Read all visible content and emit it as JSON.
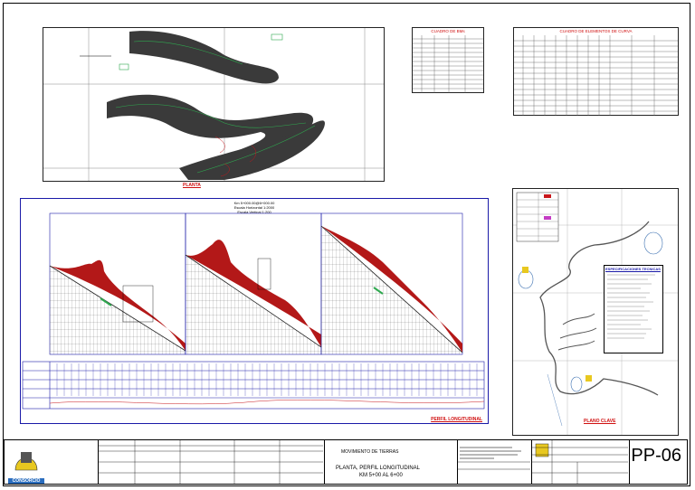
{
  "plan_label": "PLANTA",
  "profile_label": "PERFIL LONGITUDINAL",
  "profile_header": {
    "line1": "Km 5+000.00@6+000.00",
    "line2": "Escala Horizontal 1:2000",
    "line3": "Escala Vertical 1:200"
  },
  "table_bms": {
    "title": "CUADRO DE BMs"
  },
  "table_curves": {
    "title": "CUADRO DE ELEMENTOS DE CURVA"
  },
  "key_plan": {
    "title": "PLANO CLAVE",
    "specs_title": "ESPECIFICACIONES TECNICAS"
  },
  "title_block": {
    "logo_text": "CONSORCIO",
    "sheet_title": "MOVIMIENTO DE TIERRAS",
    "drawing_title": "PLANTA, PERFIL LONGITUDINAL",
    "drawing_range": "KM 5+00 AL 6+00",
    "sheet_code": "PP-06"
  },
  "colors": {
    "blue": "#1a1aa8",
    "red": "#c8161b",
    "terrain": "#444444",
    "green": "#2fa84f"
  }
}
